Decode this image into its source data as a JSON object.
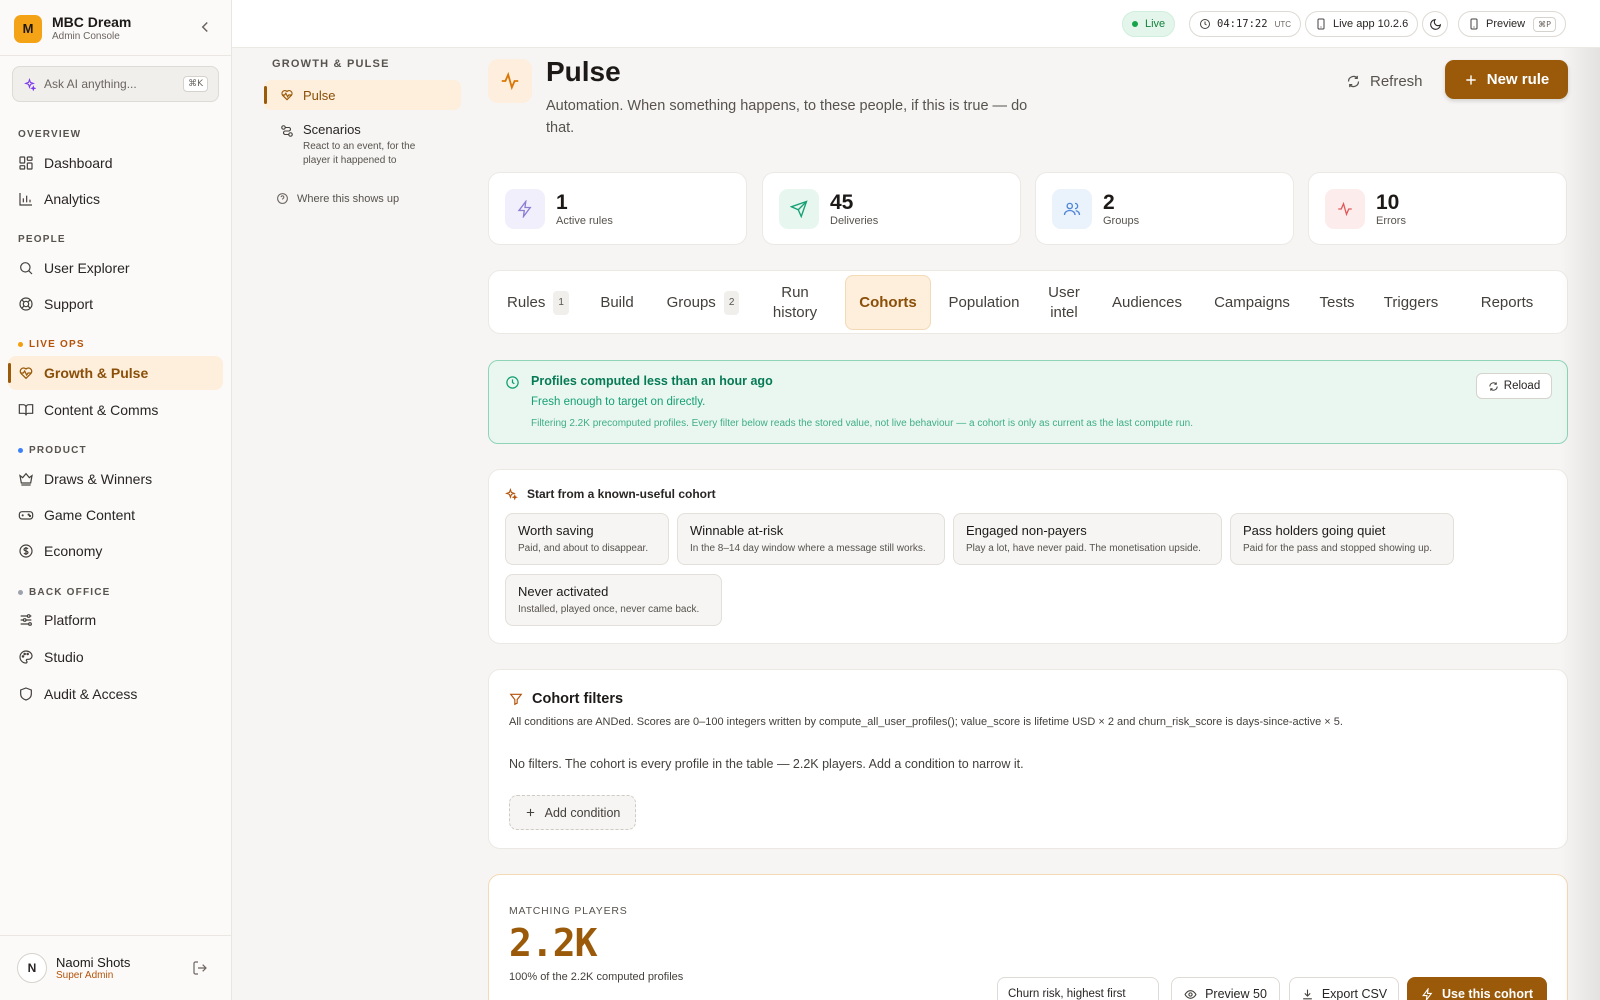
{
  "brand": {
    "logo_letter": "M",
    "name": "MBC Dream",
    "subtitle": "Admin Console"
  },
  "ask_ai": {
    "placeholder": "Ask AI anything...",
    "shortcut": "⌘K"
  },
  "sidebar": {
    "sections": {
      "overview": "OVERVIEW",
      "people": "PEOPLE",
      "live_ops": "LIVE OPS",
      "product": "PRODUCT",
      "back_office": "BACK OFFICE"
    },
    "items": {
      "dashboard": "Dashboard",
      "analytics": "Analytics",
      "user_explorer": "User Explorer",
      "support": "Support",
      "growth_pulse": "Growth & Pulse",
      "content_comms": "Content & Comms",
      "draws_winners": "Draws & Winners",
      "game_content": "Game Content",
      "economy": "Economy",
      "platform": "Platform",
      "studio": "Studio",
      "audit_access": "Audit & Access"
    },
    "active_item": "growth_pulse",
    "section_colors": {
      "live_ops": "#f59e0b",
      "product": "#3b82f6",
      "back_office": "#9ca3af"
    }
  },
  "user": {
    "initial": "N",
    "name": "Naomi Shots",
    "role": "Super Admin"
  },
  "topbar": {
    "live": "Live",
    "clock": "04:17:22",
    "timezone": "UTC",
    "app_version": "Live app 10.2.6",
    "preview": "Preview",
    "preview_shortcut": "⌘P"
  },
  "subnav": {
    "title": "GROWTH & PULSE",
    "pulse": "Pulse",
    "scenarios": "Scenarios",
    "scenarios_desc": "React to an event, for the player it happened to",
    "where": "Where this shows up"
  },
  "header": {
    "title": "Pulse",
    "subtitle": "Automation. When something happens, to these people, if this is true — do that.",
    "refresh": "Refresh",
    "new_rule": "New rule"
  },
  "stats": {
    "active_rules": {
      "value": "1",
      "label": "Active rules"
    },
    "deliveries": {
      "value": "45",
      "label": "Deliveries"
    },
    "groups": {
      "value": "2",
      "label": "Groups"
    },
    "errors": {
      "value": "10",
      "label": "Errors"
    }
  },
  "tabs": {
    "rules": "Rules",
    "rules_count": "1",
    "build": "Build",
    "groups": "Groups",
    "groups_count": "2",
    "run_history_1": "Run",
    "run_history_2": "history",
    "cohorts": "Cohorts",
    "population": "Population",
    "user_intel_1": "User",
    "user_intel_2": "intel",
    "audiences": "Audiences",
    "campaigns": "Campaigns",
    "tests": "Tests",
    "triggers": "Triggers",
    "reports": "Reports",
    "active": "cohorts"
  },
  "banner": {
    "title": "Profiles computed less than an hour ago",
    "subtitle": "Fresh enough to target on directly.",
    "note": "Filtering 2.2K precomputed profiles. Every filter below reads the stored value, not live behaviour — a cohort is only as current as the last compute run.",
    "reload": "Reload"
  },
  "presets": {
    "heading": "Start from a known-useful cohort",
    "items": [
      {
        "title": "Worth saving",
        "desc": "Paid, and about to disappear."
      },
      {
        "title": "Winnable at-risk",
        "desc": "In the 8–14 day window where a message still works."
      },
      {
        "title": "Engaged non-payers",
        "desc": "Play a lot, have never paid. The monetisation upside."
      },
      {
        "title": "Pass holders going quiet",
        "desc": "Paid for the pass and stopped showing up."
      },
      {
        "title": "Never activated",
        "desc": "Installed, played once, never came back."
      }
    ]
  },
  "filters": {
    "heading": "Cohort filters",
    "description": "All conditions are ANDed. Scores are 0–100 integers written by compute_all_user_profiles(); value_score is lifetime USD × 2 and churn_risk_score is days-since-active × 5.",
    "empty": "No filters. The cohort is every profile in the table — 2.2K players. Add a condition to narrow it.",
    "add_condition": "Add condition"
  },
  "matching": {
    "label": "MATCHING PLAYERS",
    "value": "2.2K",
    "subtitle": "100% of the 2.2K computed profiles",
    "sort": "Churn risk, highest first",
    "preview": "Preview 50",
    "export": "Export CSV",
    "use": "Use this cohort"
  },
  "colors": {
    "accent": "#9a5a0a",
    "accent_soft": "#fdefdc",
    "success": "#0f9f6e"
  }
}
